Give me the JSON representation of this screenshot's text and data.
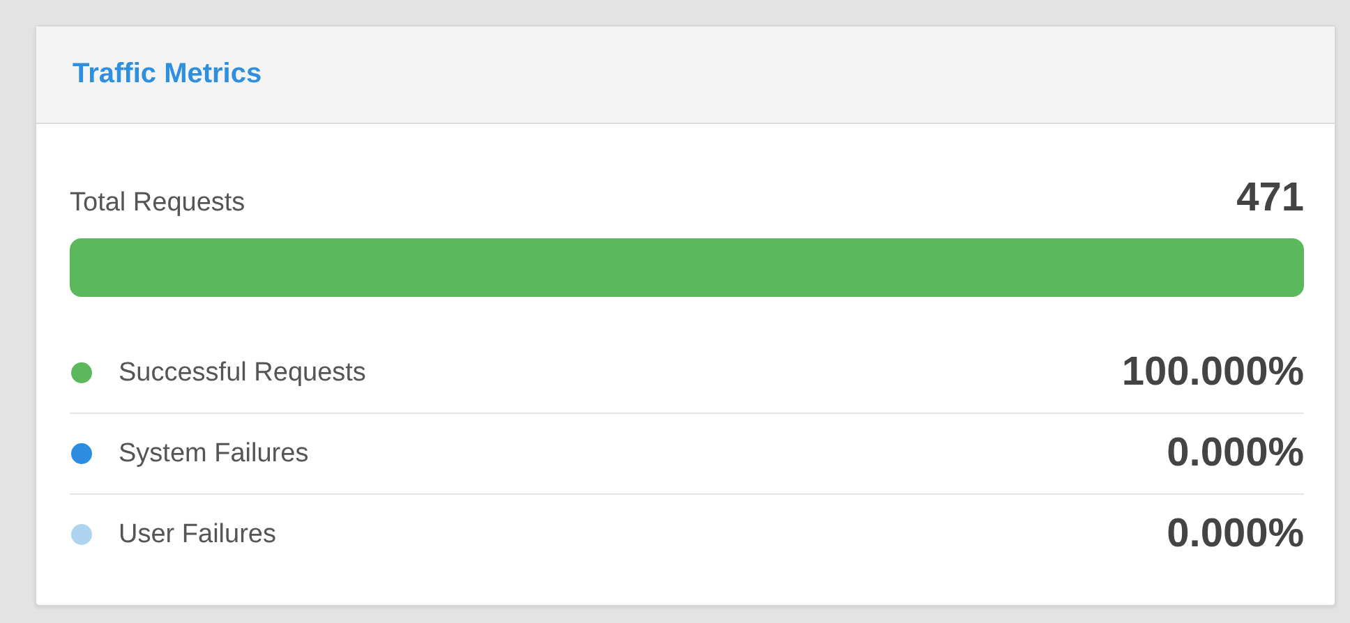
{
  "panel": {
    "title": "Traffic Metrics"
  },
  "total": {
    "label": "Total Requests",
    "value": "471",
    "level": 1
  },
  "metrics": [
    {
      "label": "Successful Requests",
      "value": "100.000%",
      "color": "#5cb85c"
    },
    {
      "label": "System Failures",
      "value": "0.000%",
      "color": "#2b8ce0"
    },
    {
      "label": "User Failures",
      "value": "0.000%",
      "color": "#aed4f0"
    }
  ]
}
